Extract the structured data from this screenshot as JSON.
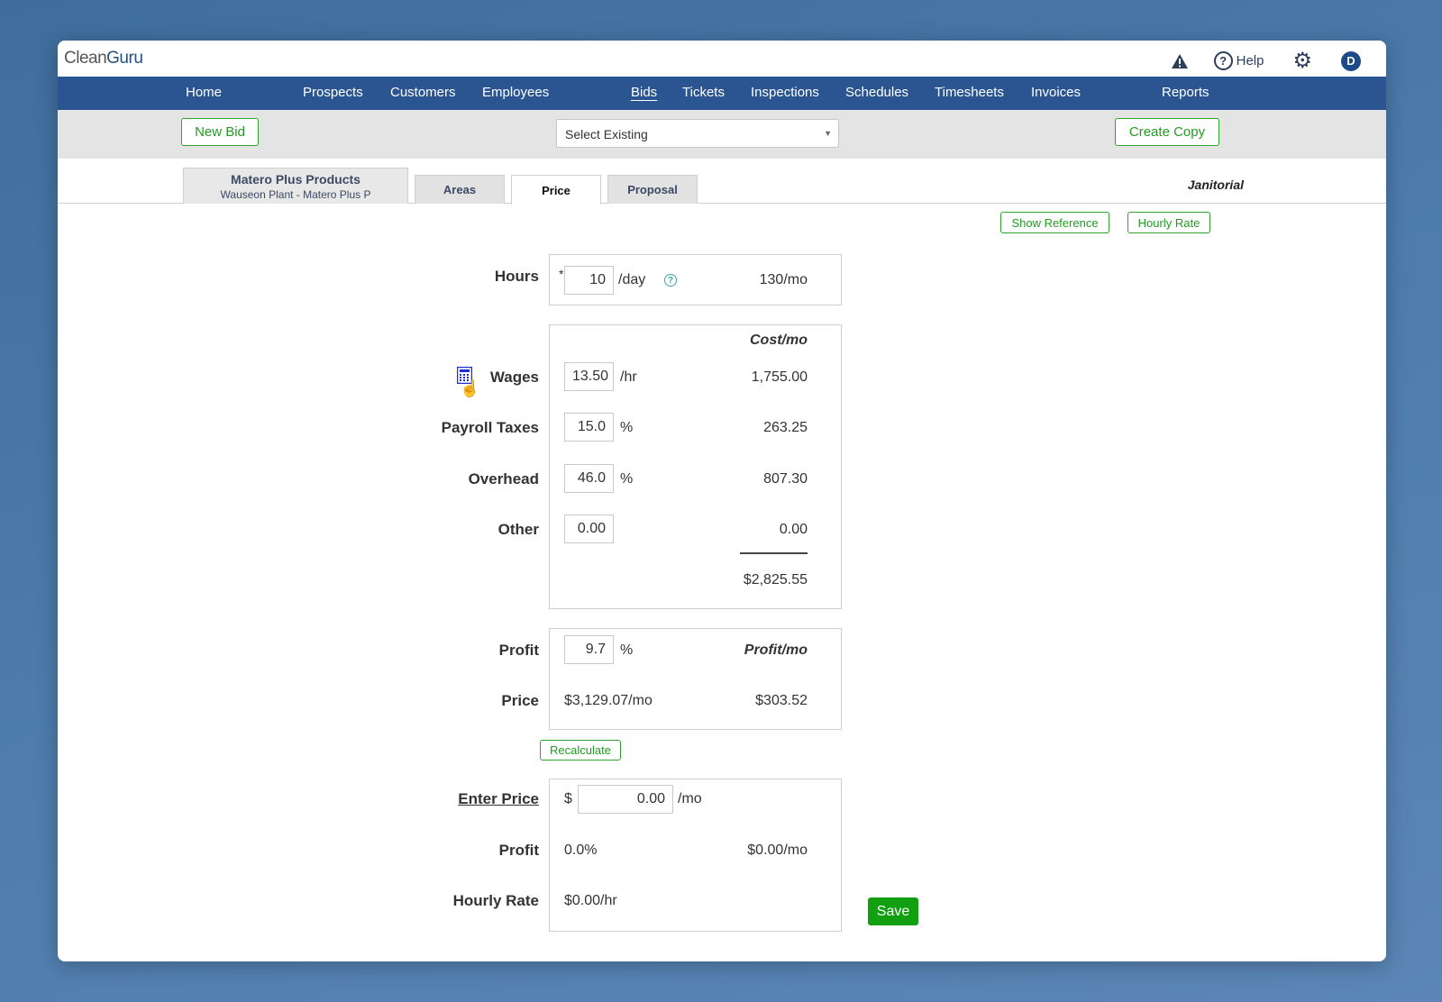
{
  "app": {
    "logo_clean": "Clean",
    "logo_guru": "Guru",
    "help_label": "Help",
    "avatar_letter": "D"
  },
  "nav": {
    "items": [
      "Home",
      "Prospects",
      "Customers",
      "Employees",
      "Bids",
      "Tickets",
      "Inspections",
      "Schedules",
      "Timesheets",
      "Invoices",
      "Reports"
    ],
    "active": "Bids"
  },
  "toolbar": {
    "new_bid": "New Bid",
    "select_existing": "Select Existing",
    "create_copy": "Create Copy"
  },
  "customer": {
    "name": "Matero Plus Products",
    "location": "Wauseon Plant - Matero Plus P"
  },
  "tabs": [
    "Areas",
    "Price",
    "Proposal"
  ],
  "active_tab": "Price",
  "service_type": "Janitorial",
  "buttons": {
    "show_reference": "Show Reference",
    "hourly_rate": "Hourly Rate",
    "recalculate": "Recalculate",
    "save": "Save"
  },
  "hours": {
    "label": "Hours",
    "asterisk": "*",
    "per_day": "10",
    "unit": "/day",
    "monthly": "130/mo"
  },
  "costs": {
    "header": "Cost/mo",
    "wages": {
      "label": "Wages",
      "value": "13.50",
      "unit": "/hr",
      "monthly": "1,755.00"
    },
    "payroll_taxes": {
      "label": "Payroll Taxes",
      "value": "15.0",
      "unit": "%",
      "monthly": "263.25"
    },
    "overhead": {
      "label": "Overhead",
      "value": "46.0",
      "unit": "%",
      "monthly": "807.30"
    },
    "other": {
      "label": "Other",
      "value": "0.00",
      "monthly": "0.00"
    },
    "total": "$2,825.55"
  },
  "profit_section": {
    "profit_label": "Profit",
    "profit_value": "9.7",
    "profit_unit": "%",
    "profit_header": "Profit/mo",
    "price_label": "Price",
    "price_value": "$3,129.07/mo",
    "profit_monthly": "$303.52"
  },
  "enter_price": {
    "label": "Enter Price",
    "currency": "$",
    "value": "0.00",
    "unit": "/mo",
    "profit_label": "Profit",
    "profit_pct": "0.0%",
    "profit_monthly": "$0.00/mo",
    "hourly_label": "Hourly Rate",
    "hourly_value": "$0.00/hr"
  },
  "colors": {
    "nav_bg": "#2a5590",
    "accent_green": "#229a22",
    "save_green": "#12a012"
  }
}
